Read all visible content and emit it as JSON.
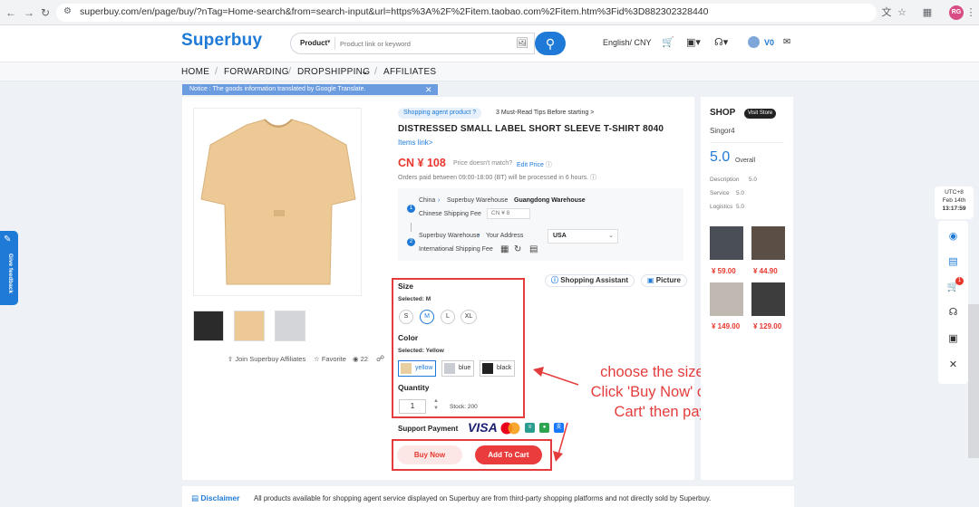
{
  "browser": {
    "url": "superbuy.com/en/page/buy/?nTag=Home-search&from=search-input&url=https%3A%2F%2Fitem.taobao.com%2Fitem.htm%3Fid%3D882302328440",
    "profile_initials": "RG",
    "icons": [
      "back-icon",
      "forward-icon",
      "reload-icon",
      "translate-icon",
      "star-icon",
      "extensions-icon"
    ]
  },
  "header": {
    "logo": "Superbuy",
    "search_type": "Product",
    "search_placeholder": "Product link or keyword",
    "lang_currency": "English/ CNY",
    "vip": "V0"
  },
  "nav": {
    "home": "HOME",
    "forwarding": "FORWARDING",
    "dropshipping": "DROPSHIPPING",
    "affiliates": "AFFILIATES"
  },
  "notice": "Notice : The goods information translated by Google Translate.",
  "product": {
    "tag": "Shopping agent product ?",
    "tips": "3 Must-Read Tips Before starting >",
    "title": "DISTRESSED SMALL LABEL SHORT SLEEVE T-SHIRT 8040",
    "items_link": "Items link>",
    "price": "CN ¥ 108",
    "price_note": "Price doesn't match?",
    "edit_price": "Edit Price",
    "orders_note": "Orders paid between 09:00-18:00 (BT) will be processed in 6 hours.",
    "affiliates": "Join Superbuy Affiliates",
    "favorite": "Favorite",
    "views": "22"
  },
  "shipping": {
    "step1_num": "1",
    "step1_from": "China",
    "step1_to": "Superbuy Warehouse",
    "step1_wh": "Guangdong Warehouse",
    "step1_fee_label": "Chinese Shipping Fee",
    "step1_fee": "CN ¥ 8",
    "step2_num": "2",
    "step2_from": "Superbuy Warehouse",
    "step2_to": "Your Address",
    "step2_fee_label": "International Shipping Fee",
    "country": "USA"
  },
  "tools": {
    "assistant": "Shopping Assistant",
    "picture": "Picture"
  },
  "options": {
    "size_heading": "Size",
    "size_selected": "Selected: M",
    "sizes": [
      "S",
      "M",
      "L",
      "XL"
    ],
    "color_heading": "Color",
    "color_selected": "Selected: Yellow",
    "colors": [
      {
        "label": "yellow",
        "swatch": "#e8cf9f"
      },
      {
        "label": "blue",
        "swatch": "#c9ccd3"
      },
      {
        "label": "black",
        "swatch": "#222222"
      }
    ],
    "quantity_heading": "Quantity",
    "quantity": "1",
    "stock": "Stock: 200"
  },
  "payment": {
    "label": "Support Payment",
    "visa": "VISA"
  },
  "actions": {
    "buy_now": "Buy Now",
    "add_to_cart": "Add To Cart"
  },
  "annotation": {
    "line1": "choose the size,color,etc..",
    "line2": "Click 'Buy Now' or 'Add To",
    "line3": "Cart' then pay for it"
  },
  "shop": {
    "heading": "SHOP",
    "visit": "Visit Store",
    "name": "Singor4",
    "score": "5.0",
    "overall": "Overall",
    "description": "Description",
    "description_score": "5.0",
    "service": "Service",
    "service_score": "5.0",
    "logistics": "Logistics",
    "logistics_score": "5.0",
    "prices": [
      "¥ 59.00",
      "¥ 44.90",
      "¥ 149.00",
      "¥ 129.00"
    ]
  },
  "disclaimer": {
    "heading": "Disclaimer",
    "text": "All products available for shopping agent service displayed on Superbuy are from third-party shopping platforms and not directly sold by Superbuy."
  },
  "feedback": "Give feedback",
  "clock": {
    "tz": "UTC+8",
    "date": "Feb 14th",
    "time": "13:17:59"
  },
  "rail": {
    "cart_count": "1"
  },
  "colors": {
    "brand": "#1e7ad6",
    "price": "#e8382e",
    "annotation": "#e43c3c"
  }
}
